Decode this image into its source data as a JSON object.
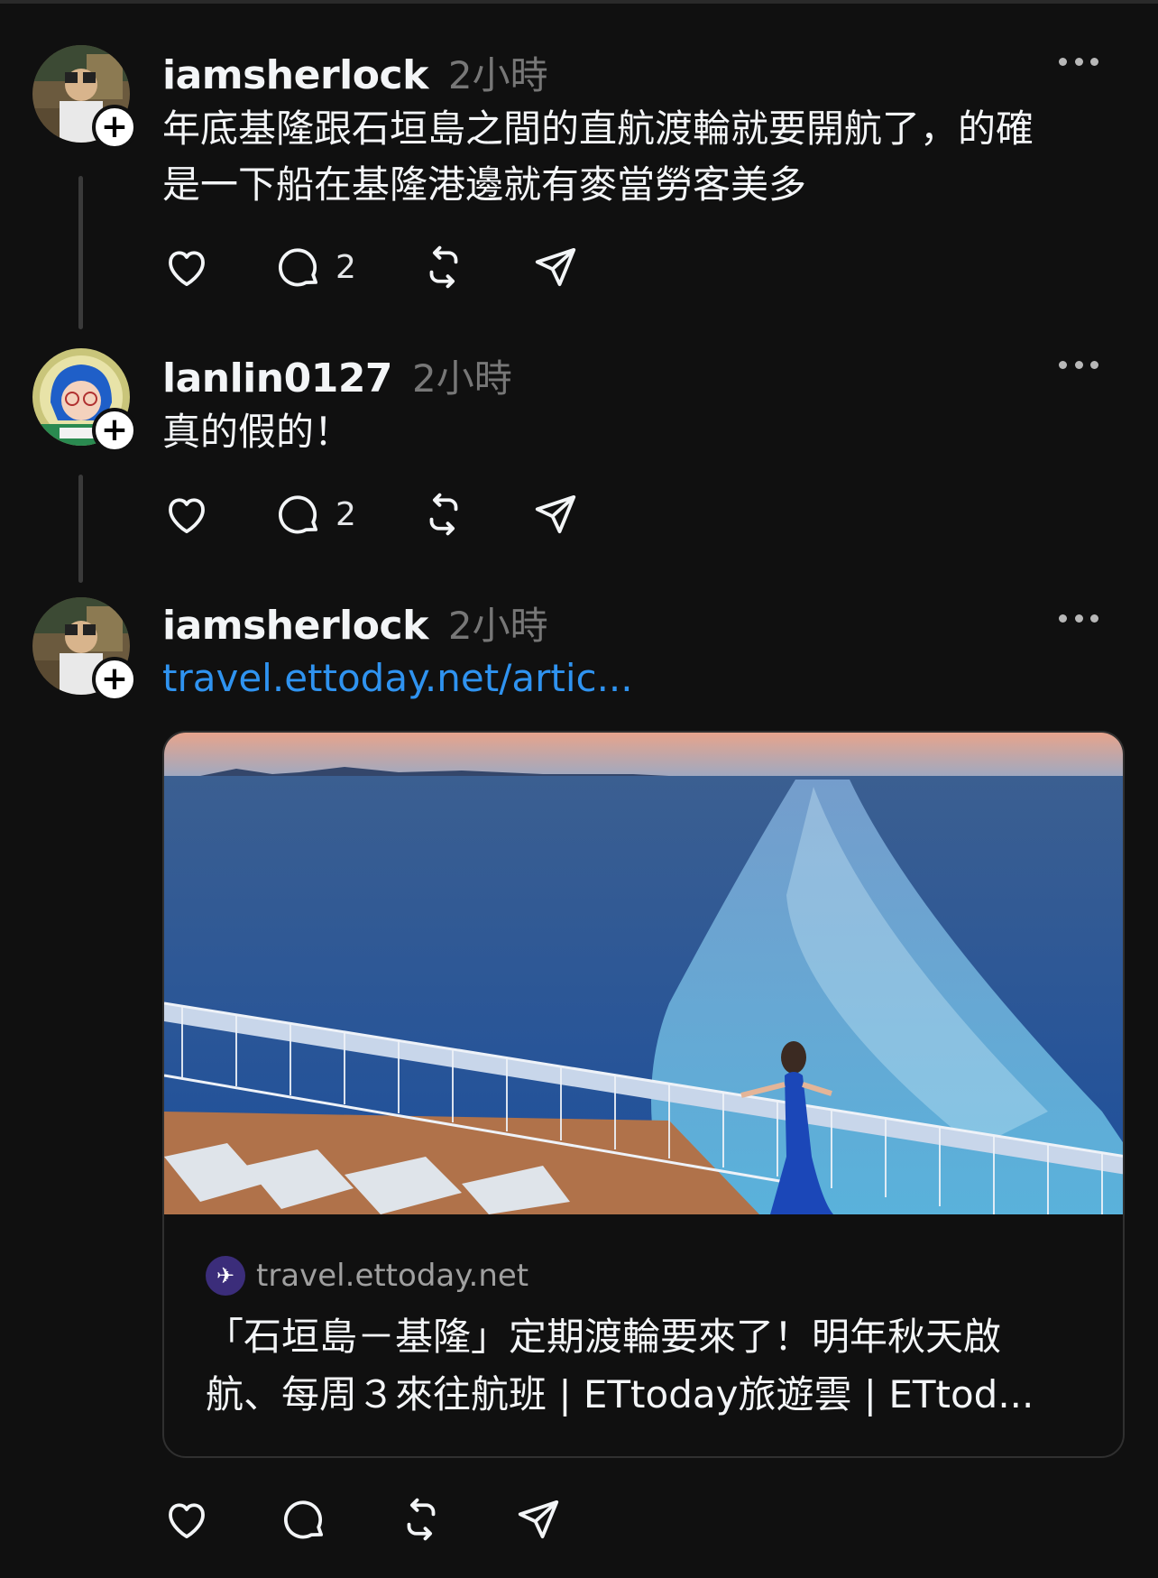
{
  "posts": [
    {
      "username": "iamsherlock",
      "time": "2小時",
      "text_line1": "年底基隆跟石垣島之間的直航渡輪就要開航了，的確",
      "text_line2": "是一下船在基隆港邊就有麥當勞客美多",
      "replies": "2"
    },
    {
      "username": "lanlin0127",
      "time": "2小時",
      "text_line1": "真的假的！",
      "replies": "2"
    },
    {
      "username": "iamsherlock",
      "time": "2小時",
      "link": "travel.ettoday.net/artic...",
      "card": {
        "site": "travel.ettoday.net",
        "title_line1": "「石垣島－基隆」定期渡輪要來了！明年秋天啟",
        "title_line2": "航、每周３來往航班 | ETtoday旅遊雲 | ETtod..."
      }
    }
  ],
  "colors": {
    "background": "#101010",
    "link": "#2f93f0",
    "muted": "#777777"
  },
  "icons": [
    "plus-icon",
    "more-icon",
    "heart-icon",
    "comment-icon",
    "repost-icon",
    "share-icon",
    "plane-icon"
  ]
}
